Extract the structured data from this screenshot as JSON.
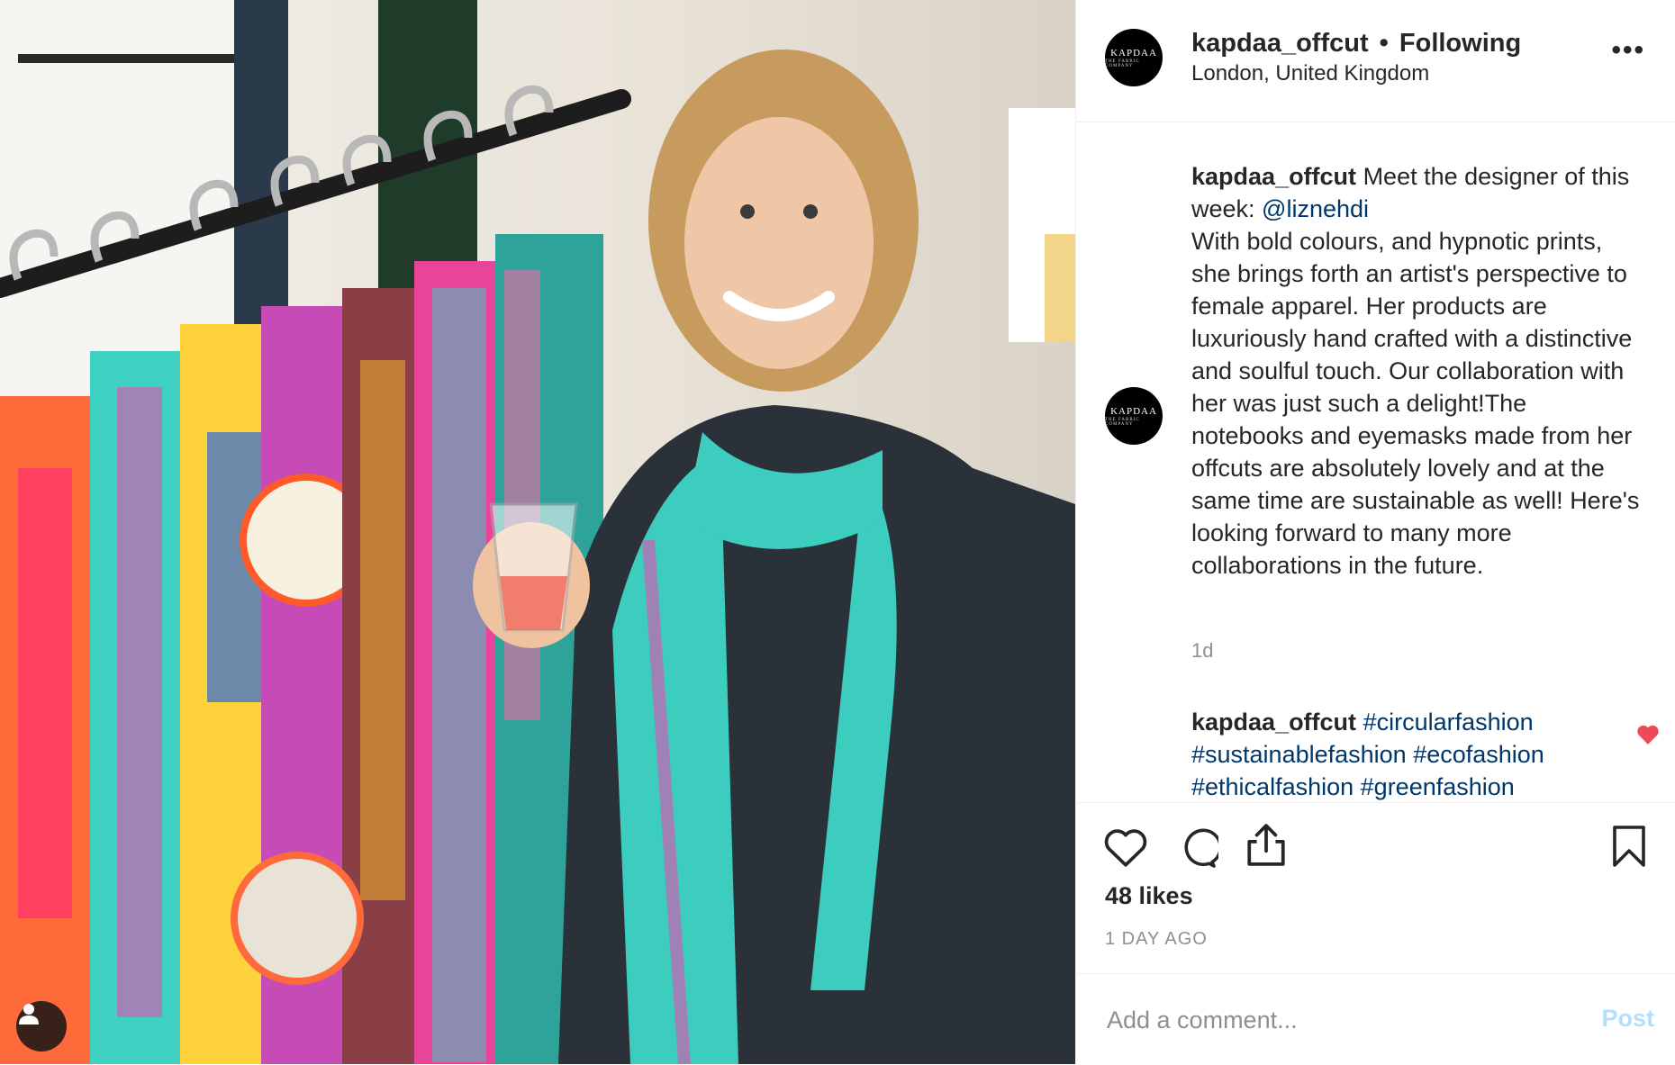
{
  "post": {
    "username": "kapdaa_offcut",
    "follow_status": "Following",
    "separator": "•",
    "location": "London, United Kingdom",
    "more_label": "•••",
    "avatar": {
      "brand": "KAPDAA",
      "sub": "THE FABRIC COMPANY"
    }
  },
  "caption": {
    "username": "kapdaa_offcut",
    "text_before": "Meet the designer of this week: ",
    "mention": "@liznehdi",
    "text_after": "With bold colours, and hypnotic prints, she brings forth an artist's perspective to female apparel. Her products are luxuriously hand crafted with a distinctive and soulful touch. Our collaboration with her was just such a delight!The notebooks and eyemasks made from her offcuts are absolutely lovely and at the same time are sustainable as well! Here's looking forward to many more collaborations in the future.",
    "time": "1d"
  },
  "hashtag_comment": {
    "username": "kapdaa_offcut",
    "tags": [
      "#circularfashion",
      "#sustainablefashion",
      "#ecofashion",
      "#ethicalfashion",
      "#greenfashion"
    ]
  },
  "actions": {
    "icons": [
      "heart-icon",
      "comment-icon",
      "share-icon",
      "bookmark-icon"
    ],
    "likes": "48 likes",
    "date": "1 DAY AGO"
  },
  "add_comment": {
    "placeholder": "Add a comment...",
    "post_label": "Post"
  },
  "colors": {
    "text": "#262626",
    "secondary": "#8e8e8e",
    "link": "#00376b",
    "like_red": "#ed4956",
    "post_disabled": "#b2dffc"
  }
}
